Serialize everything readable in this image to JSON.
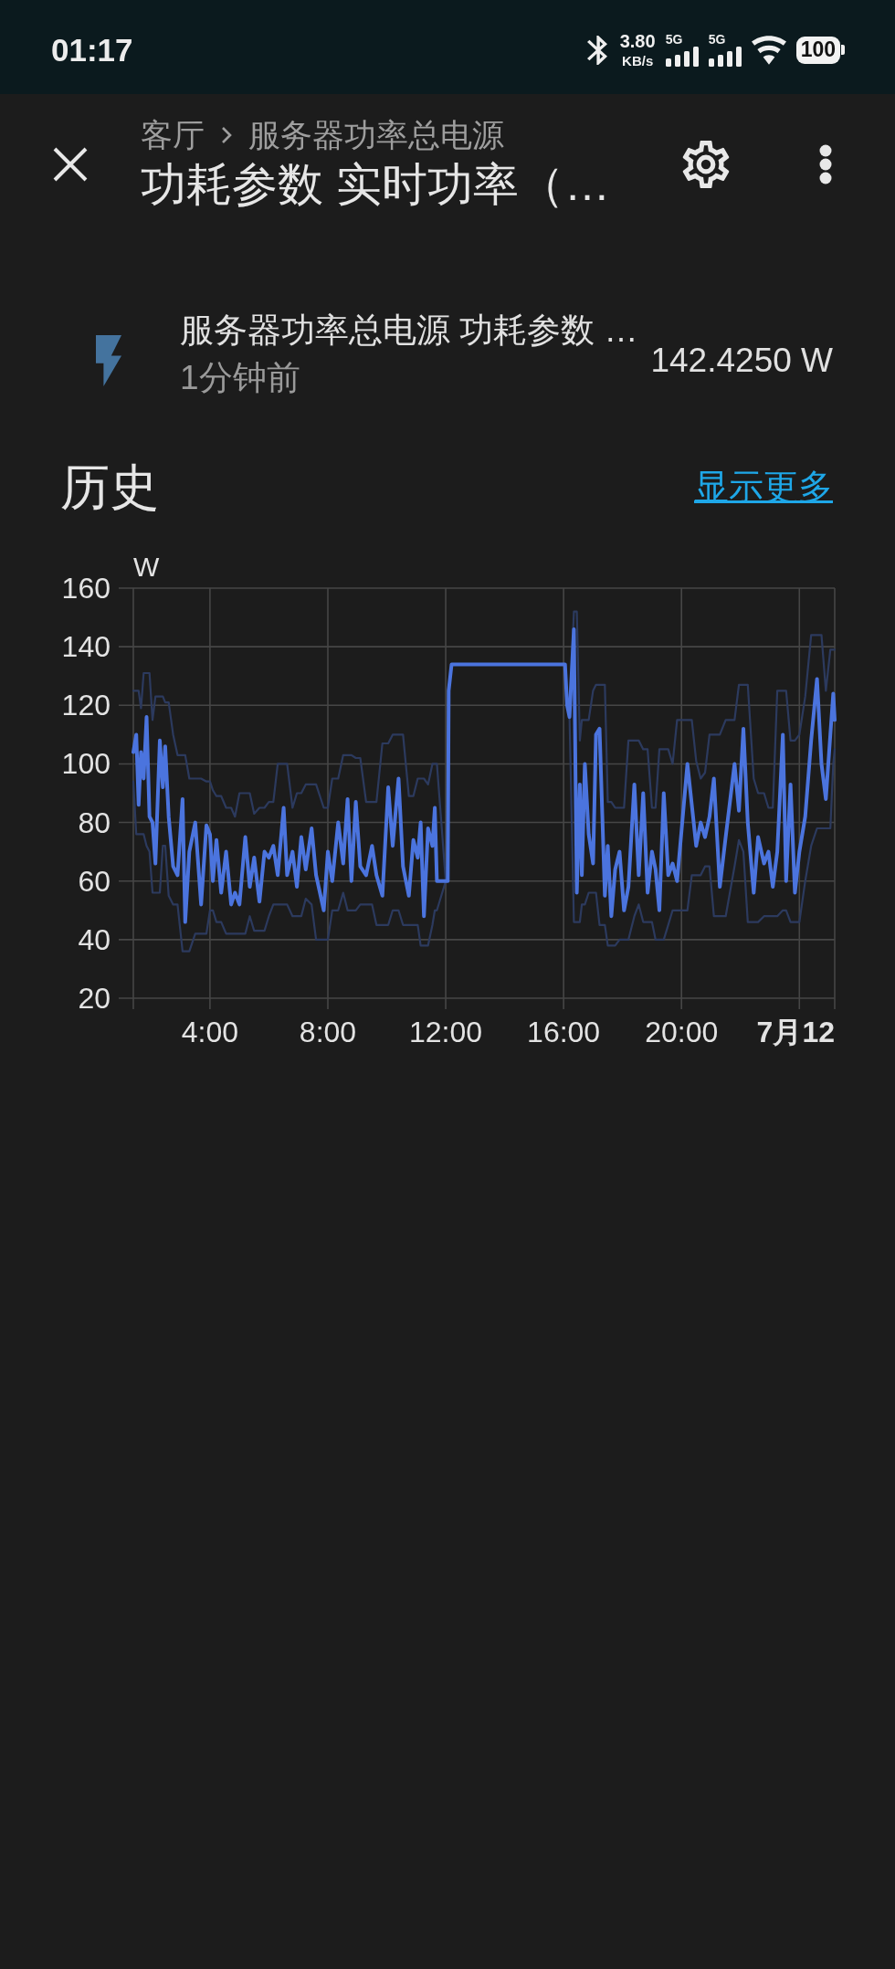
{
  "status_bar": {
    "time": "01:17",
    "net_speed": {
      "value": "3.80",
      "unit": "KB/s"
    },
    "signals": [
      {
        "label": "5G"
      },
      {
        "label": "5G"
      }
    ],
    "battery": "100"
  },
  "header": {
    "breadcrumb": [
      "客厅",
      "服务器功率总电源"
    ],
    "title": "功耗参数 实时功率（…"
  },
  "entity": {
    "name": "服务器功率总电源 功耗参数 …",
    "updated": "1分钟前",
    "value": "142.4250 W"
  },
  "history": {
    "title": "历史",
    "link": "显示更多",
    "chart_data": {
      "type": "line",
      "grid": true,
      "ylabel": "W",
      "x": [
        1.4,
        1.5,
        1.58,
        1.66,
        1.75,
        1.85,
        1.95,
        2.05,
        2.15,
        2.3,
        2.4,
        2.48,
        2.6,
        2.75,
        2.9,
        3.07,
        3.16,
        3.3,
        3.5,
        3.7,
        3.88,
        4.0,
        4.1,
        4.22,
        4.38,
        4.55,
        4.72,
        4.85,
        5.0,
        5.2,
        5.35,
        5.5,
        5.68,
        5.85,
        6.0,
        6.15,
        6.3,
        6.5,
        6.62,
        6.8,
        6.95,
        7.1,
        7.25,
        7.45,
        7.6,
        7.86,
        8.0,
        8.15,
        8.35,
        8.52,
        8.67,
        8.8,
        8.95,
        9.1,
        9.3,
        9.5,
        9.65,
        9.85,
        10.05,
        10.2,
        10.4,
        10.55,
        10.75,
        10.9,
        11.05,
        11.15,
        11.26,
        11.4,
        11.55,
        11.63,
        11.7,
        12.0,
        12.07,
        12.1,
        12.2,
        16.05,
        16.12,
        16.2,
        16.35,
        16.45,
        16.55,
        16.62,
        16.72,
        16.85,
        17.0,
        17.1,
        17.22,
        17.4,
        17.5,
        17.62,
        17.75,
        17.9,
        18.05,
        18.2,
        18.4,
        18.55,
        18.7,
        18.85,
        19.0,
        19.12,
        19.25,
        19.4,
        19.55,
        19.7,
        19.85,
        20.2,
        20.35,
        20.5,
        20.65,
        20.8,
        20.95,
        21.1,
        21.3,
        21.5,
        21.8,
        21.95,
        22.1,
        22.25,
        22.45,
        22.6,
        22.8,
        22.95,
        23.1,
        23.25,
        23.44,
        23.55,
        23.7,
        23.85,
        24.0,
        24.2,
        24.4,
        24.6,
        24.75,
        24.9,
        25.05,
        25.15,
        25.2
      ],
      "series": [
        {
          "color": "#4b74de",
          "values": [
            104,
            110,
            86,
            104,
            95,
            116,
            82,
            80,
            66,
            108,
            92,
            106,
            82,
            65,
            62,
            88,
            46,
            70,
            80,
            52,
            79,
            76,
            60,
            74,
            56,
            70,
            52,
            56,
            52,
            75,
            58,
            68,
            53,
            70,
            68,
            72,
            62,
            85,
            62,
            70,
            58,
            75,
            64,
            78,
            62,
            50,
            70,
            60,
            80,
            66,
            88,
            60,
            87,
            65,
            62,
            72,
            62,
            55,
            92,
            72,
            95,
            65,
            55,
            74,
            68,
            80,
            48,
            78,
            72,
            85,
            60,
            60,
            60,
            125,
            134,
            134,
            120,
            116,
            146,
            56,
            93,
            62,
            100,
            76,
            66,
            110,
            112,
            55,
            72,
            48,
            64,
            70,
            50,
            58,
            93,
            62,
            90,
            56,
            70,
            64,
            50,
            90,
            62,
            66,
            60,
            100,
            86,
            72,
            80,
            75,
            82,
            95,
            58,
            75,
            100,
            84,
            112,
            80,
            56,
            75,
            66,
            70,
            58,
            70,
            110,
            60,
            93,
            56,
            70,
            82,
            108,
            129,
            100,
            88,
            110,
            124,
            115
          ]
        },
        {
          "color": "#2c3a5e",
          "values": [
            125,
            125,
            125,
            119,
            131,
            131,
            131,
            115,
            123,
            123,
            123,
            121,
            121,
            110,
            103,
            103,
            103,
            95,
            95,
            95,
            94,
            94,
            91,
            89,
            89,
            85,
            85,
            82,
            90,
            90,
            90,
            83,
            85,
            85,
            87,
            87,
            100,
            100,
            100,
            85,
            90,
            90,
            93,
            93,
            93,
            85,
            85,
            95,
            95,
            103,
            103,
            103,
            102,
            102,
            87,
            87,
            87,
            107,
            107,
            110,
            110,
            110,
            89,
            89,
            95,
            95,
            95,
            93,
            100,
            100,
            100,
            60,
            60,
            125,
            134,
            134,
            120,
            116,
            152,
            152,
            108,
            115,
            115,
            115,
            125,
            127,
            127,
            127,
            87,
            87,
            85,
            85,
            85,
            108,
            108,
            108,
            105,
            105,
            85,
            85,
            105,
            105,
            105,
            100,
            115,
            115,
            115,
            101,
            95,
            97,
            110,
            110,
            110,
            115,
            115,
            127,
            127,
            127,
            95,
            90,
            90,
            85,
            85,
            125,
            125,
            125,
            108,
            108,
            110,
            123,
            144,
            144,
            144,
            125,
            139,
            139,
            139
          ]
        },
        {
          "color": "#2c3a5e",
          "values": [
            94,
            76,
            76,
            76,
            76,
            72,
            70,
            56,
            56,
            56,
            72,
            72,
            55,
            52,
            52,
            36,
            36,
            36,
            42,
            42,
            42,
            50,
            50,
            46,
            46,
            42,
            42,
            42,
            42,
            42,
            48,
            43,
            43,
            43,
            48,
            52,
            52,
            52,
            52,
            48,
            48,
            48,
            54,
            52,
            40,
            40,
            40,
            50,
            50,
            56,
            50,
            50,
            50,
            52,
            52,
            52,
            45,
            45,
            45,
            50,
            50,
            45,
            45,
            45,
            45,
            38,
            38,
            38,
            45,
            50,
            50,
            60,
            60,
            125,
            134,
            134,
            120,
            116,
            46,
            46,
            46,
            52,
            52,
            56,
            56,
            56,
            45,
            45,
            38,
            38,
            38,
            40,
            40,
            40,
            48,
            52,
            46,
            46,
            46,
            40,
            40,
            40,
            45,
            50,
            50,
            50,
            62,
            62,
            62,
            65,
            65,
            48,
            48,
            48,
            65,
            74,
            70,
            46,
            46,
            46,
            48,
            48,
            48,
            48,
            50,
            50,
            46,
            46,
            46,
            60,
            72,
            78,
            78,
            78,
            78,
            100,
            105
          ]
        }
      ],
      "xlim": [
        1.4,
        25.2
      ],
      "ylim": [
        20,
        160
      ],
      "xticks": [
        {
          "value": 4,
          "label": "4:00"
        },
        {
          "value": 8,
          "label": "8:00"
        },
        {
          "value": 12,
          "label": "12:00"
        },
        {
          "value": 16,
          "label": "16:00"
        },
        {
          "value": 20,
          "label": "20:00"
        },
        {
          "value": 24,
          "label": "7月12"
        }
      ],
      "yticks": [
        20,
        40,
        60,
        80,
        100,
        120,
        140,
        160
      ]
    }
  }
}
